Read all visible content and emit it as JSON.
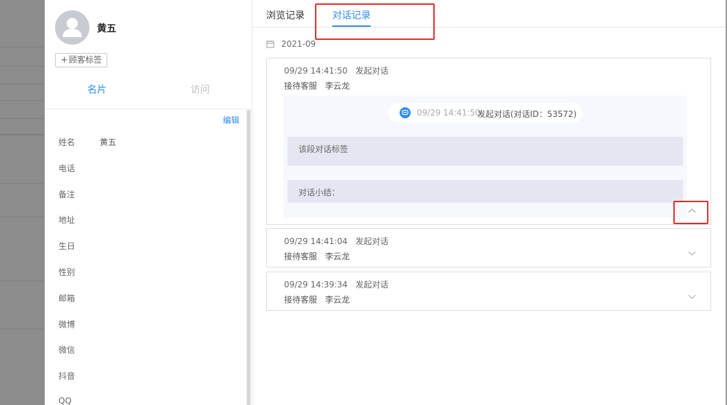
{
  "customer": {
    "name": "黄五",
    "tag_button": "顾客标签",
    "tabs": [
      "名片",
      "访问"
    ],
    "edit_label": "编辑",
    "fields": [
      {
        "label": "姓名",
        "value": "黄五"
      },
      {
        "label": "电话",
        "value": ""
      },
      {
        "label": "备注",
        "value": ""
      },
      {
        "label": "地址",
        "value": ""
      },
      {
        "label": "生日",
        "value": ""
      },
      {
        "label": "性别",
        "value": ""
      },
      {
        "label": "邮箱",
        "value": ""
      },
      {
        "label": "微博",
        "value": ""
      },
      {
        "label": "微信",
        "value": ""
      },
      {
        "label": "抖音",
        "value": ""
      },
      {
        "label": "QQ",
        "value": ""
      }
    ]
  },
  "main": {
    "tabs": [
      {
        "label": "浏览记录",
        "active": false
      },
      {
        "label": "对话记录",
        "active": true
      }
    ],
    "month": "2021-09",
    "conversations": [
      {
        "time": "09/29 14:41:50",
        "action": "发起对话",
        "agent_label": "接待客服",
        "agent": "李云龙",
        "expanded": true,
        "detail": {
          "start_time": "09/29 14:41:50",
          "start_text": "发起对话(对话ID：53572)",
          "tag_label": "该段对话标签",
          "summary_label": "对话小结："
        }
      },
      {
        "time": "09/29 14:41:04",
        "action": "发起对话",
        "agent_label": "接待客服",
        "agent": "李云龙",
        "expanded": false
      },
      {
        "time": "09/29 14:39:34",
        "action": "发起对话",
        "agent_label": "接待客服",
        "agent": "李云龙",
        "expanded": false
      }
    ]
  },
  "colors": {
    "accent": "#2d8cf0",
    "highlight": "#e02a2a",
    "overlay": "#8a8a8a"
  }
}
